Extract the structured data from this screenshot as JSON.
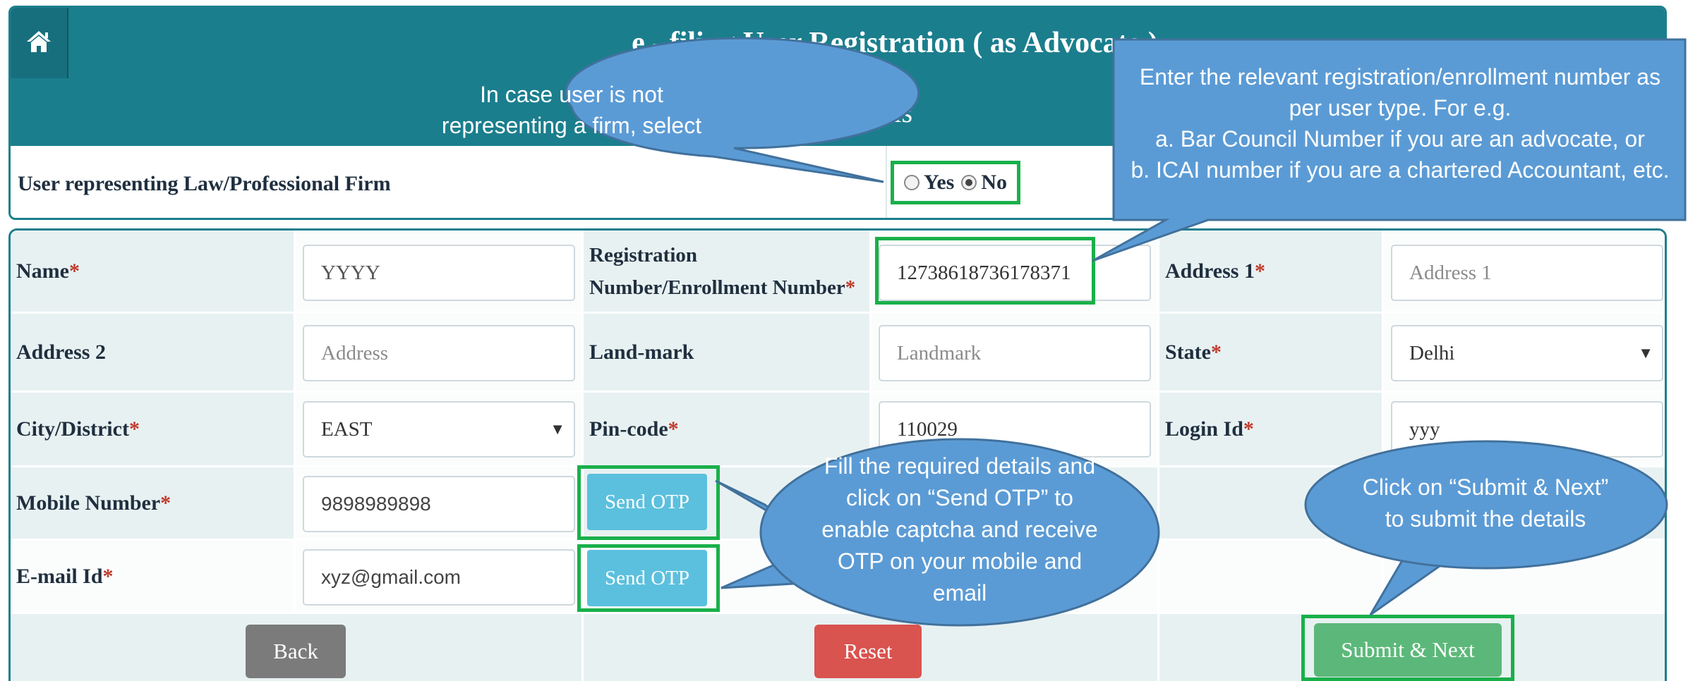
{
  "header": {
    "title": "e - filing User Registration ( as Advocate )",
    "subtitle": "Basic Details",
    "home_icon": "home-icon"
  },
  "firm": {
    "label": "User representing Law/Professional Firm",
    "options": [
      "Yes",
      "No"
    ],
    "selected": "No"
  },
  "form": {
    "name": {
      "label": "Name",
      "value": "YYYY"
    },
    "registration": {
      "label_line1": "Registration",
      "label_line2": "Number/Enrollment Number",
      "value": "12738618736178371"
    },
    "address1": {
      "label": "Address 1",
      "placeholder": "Address 1"
    },
    "address2": {
      "label": "Address 2",
      "placeholder": "Address"
    },
    "landmark": {
      "label": "Land-mark",
      "placeholder": "Landmark"
    },
    "state": {
      "label": "State",
      "value": "Delhi"
    },
    "city": {
      "label": "City/District",
      "value": "EAST"
    },
    "pincode": {
      "label": "Pin-code",
      "value": "110029"
    },
    "login": {
      "label": "Login Id",
      "value": "yyy"
    },
    "mobile": {
      "label": "Mobile Number",
      "value": "9898989898"
    },
    "email": {
      "label": "E-mail Id",
      "value": "xyz@gmail.com"
    },
    "required_mark": "*"
  },
  "buttons": {
    "send_otp_mobile": "Send OTP",
    "send_otp_email": "Send OTP",
    "back": "Back",
    "reset": "Reset",
    "submit": "Submit & Next"
  },
  "callouts": {
    "firm_hint": "In case user is not representing a firm, select “No”",
    "registration_hint_line1": "Enter the relevant registration/enrollment number as per user type. For e.g.",
    "registration_hint_line2": "a. Bar Council Number if you are an advocate, or",
    "registration_hint_line3": "b. ICAI number if you are a chartered Accountant, etc.",
    "otp_hint": "Fill the required details and click on “Send OTP” to enable captcha and receive OTP on your mobile and email",
    "submit_hint": "Click on “Submit & Next” to submit the details"
  },
  "colors": {
    "header": "#1b7e8d",
    "highlight": "#19b04a",
    "callout": "#5b9bd5",
    "otp_button": "#5bc0de",
    "back_button": "#7b7b7b",
    "reset_button": "#d9534f",
    "submit_button": "#5cb87a"
  }
}
